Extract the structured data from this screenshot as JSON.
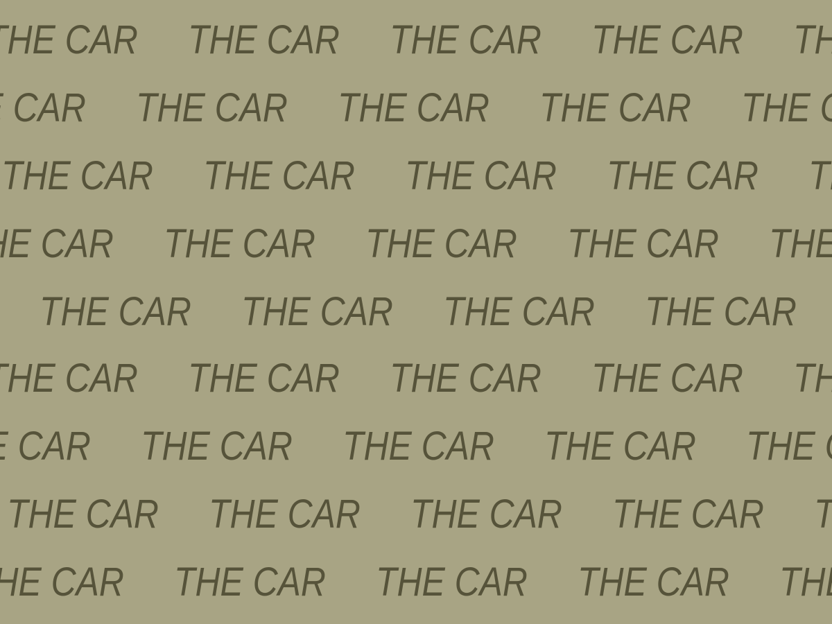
{
  "pattern": {
    "text": "THE CAR",
    "background_color": "#a8a484",
    "text_color": "#56533a",
    "style": "italic condensed repeating wordmark pattern",
    "rows": 9,
    "words_per_row": 5
  }
}
